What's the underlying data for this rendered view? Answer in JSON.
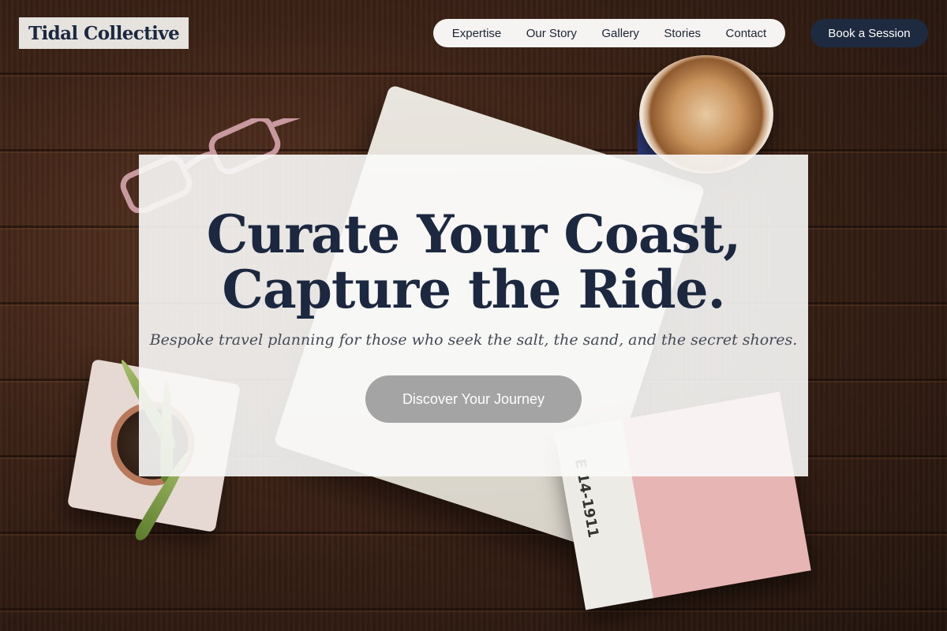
{
  "brand": {
    "name": "Tidal Collective"
  },
  "nav": {
    "items": [
      {
        "label": "Expertise"
      },
      {
        "label": "Our Story"
      },
      {
        "label": "Gallery"
      },
      {
        "label": "Stories"
      },
      {
        "label": "Contact"
      }
    ],
    "cta_label": "Book a Session"
  },
  "hero": {
    "title_line1": "Curate Your Coast,",
    "title_line2": "Capture the Ride.",
    "subtitle": "Bespoke travel planning for those who seek the salt, the sand, and the secret shores.",
    "button_label": "Discover Your Journey"
  },
  "background": {
    "card_text": "E 14-1911"
  },
  "colors": {
    "navy": "#1e2a40",
    "hero_button": "#a4a4a4",
    "nav_bg": "#f5f4f2"
  }
}
